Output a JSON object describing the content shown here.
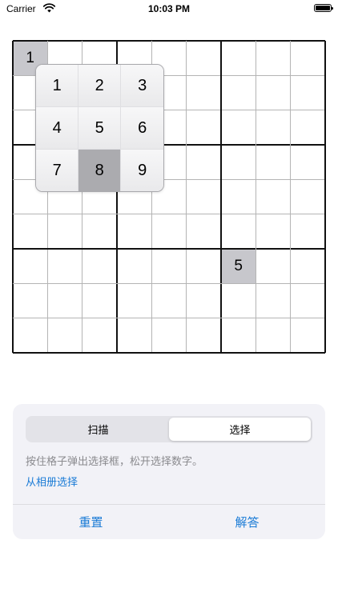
{
  "status_bar": {
    "carrier": "Carrier",
    "time": "10:03 PM",
    "wifi_icon": "wifi-icon",
    "battery_icon": "battery-icon",
    "battery_level": 1.0
  },
  "grid": {
    "highlight_color": "#c7c7cc",
    "cells": [
      {
        "row": 0,
        "col": 0,
        "value": "1",
        "highlighted": true
      },
      {
        "row": 6,
        "col": 6,
        "value": "5",
        "highlighted": true
      }
    ]
  },
  "picker": {
    "keys": [
      "1",
      "2",
      "3",
      "4",
      "5",
      "6",
      "7",
      "8",
      "9"
    ],
    "selected": "8"
  },
  "panel": {
    "tabs": [
      {
        "label": "扫描",
        "active": false
      },
      {
        "label": "选择",
        "active": true
      }
    ],
    "hint": "按住格子弹出选择框，松开选择数字。",
    "album_link": "从相册选择",
    "reset_label": "重置",
    "solve_label": "解答",
    "accent_color": "#1a7bd6"
  }
}
